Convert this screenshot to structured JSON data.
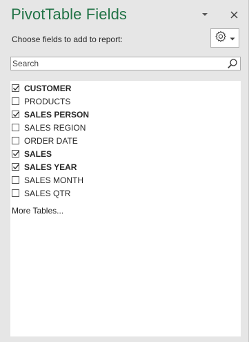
{
  "pane": {
    "title": "PivotTable Fields",
    "subtitle": "Choose fields to add to report:"
  },
  "header_icons": {
    "dropdown": "chevron-down-icon",
    "close": "close-icon",
    "tools": "gear-icon"
  },
  "search": {
    "placeholder": "Search",
    "value": "",
    "icon": "search-icon"
  },
  "fields": [
    {
      "label": "CUSTOMER",
      "checked": true
    },
    {
      "label": "PRODUCTS",
      "checked": false
    },
    {
      "label": "SALES PERSON",
      "checked": true
    },
    {
      "label": "SALES REGION",
      "checked": false
    },
    {
      "label": "ORDER DATE",
      "checked": false
    },
    {
      "label": "SALES",
      "checked": true
    },
    {
      "label": "SALES YEAR",
      "checked": true
    },
    {
      "label": "SALES MONTH",
      "checked": false
    },
    {
      "label": "SALES QTR",
      "checked": false
    }
  ],
  "more_tables_label": "More Tables...",
  "colors": {
    "title": "#217346",
    "pane_bg": "#e6e6e6",
    "list_bg": "#ffffff",
    "text": "#262626"
  }
}
